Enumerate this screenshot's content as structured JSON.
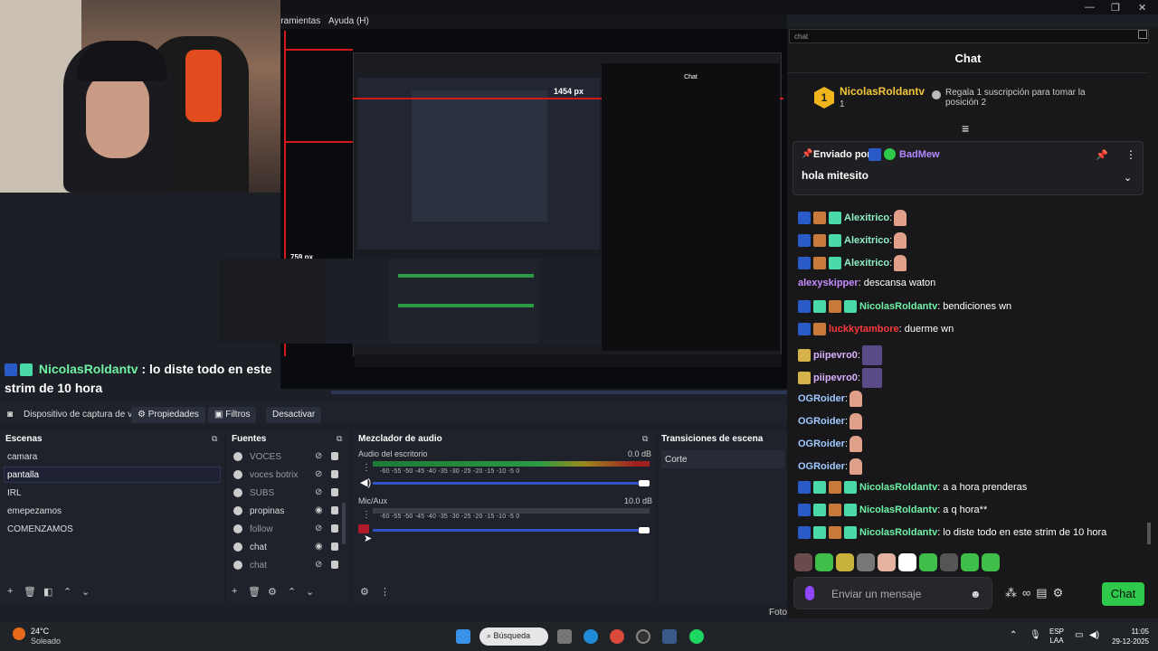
{
  "menubar": {
    "herramientas": "rramientas",
    "ayuda": "Ayuda (H)"
  },
  "window_controls": {
    "min": "—",
    "max": "❐",
    "close": "✕"
  },
  "preview": {
    "px_a": "1454 px",
    "px_b": "759 px",
    "nested_chat_title": "Chat"
  },
  "overlay": {
    "user": "NicolasRoldantv",
    "sep": ":",
    "message": "lo diste todo en este strim de 10 hora"
  },
  "source_bar": {
    "device": "Dispositivo de captura de v",
    "properties": "Propiedades",
    "filters": "Filtros",
    "deactivate": "Desactivar"
  },
  "scenes": {
    "title": "Escenas",
    "items": [
      "camara",
      "pantalla",
      "IRL",
      "emepezamos",
      "COMENZAMOS"
    ]
  },
  "sources": {
    "title": "Fuentes",
    "items": [
      "VOCES",
      "voces botrix",
      "SUBS",
      "propinas",
      "follow",
      "chat",
      "chat"
    ]
  },
  "mixer": {
    "title": "Mezclador de audio",
    "ch1": {
      "name": "Audio del escritorio",
      "db": "0.0 dB"
    },
    "ch2": {
      "name": "Mic/Aux",
      "db": "10.0 dB"
    },
    "scale": "-60    -55    -50    -45    -40    -35    -30    -25    -20    -15    -10     -5      0"
  },
  "transitions": {
    "title": "Transiciones de escena",
    "item": "Corte"
  },
  "chat": {
    "input_top": "chat",
    "title": "Chat",
    "rank_num": "1",
    "rank_name": "NicolasRoldantv",
    "rank_count": "1",
    "rank_sub": "Regala 1 suscripción para tomar la posición 2",
    "pinned_by": "Enviado por",
    "pinned_user": "BadMew",
    "pinned_msg": "hola mitesito",
    "messages": [
      {
        "user": "Alexitrico",
        "text": ":",
        "color": "#8ff0c4"
      },
      {
        "user": "Alexitrico",
        "text": ":",
        "color": "#8ff0c4"
      },
      {
        "user": "Alexitrico",
        "text": ":",
        "color": "#8ff0c4"
      },
      {
        "user": "alexyskipper",
        "text": ": descansa waton",
        "color": "#c68cff"
      },
      {
        "user": "NicolasRoldantv",
        "text": ": bendiciones wn",
        "color": "#6ff2a6"
      },
      {
        "user": "luckkytambore",
        "text": ": duerme wn",
        "color": "#ff3a3a"
      },
      {
        "user": "piipevro0",
        "text": ":",
        "color": "#d9b0ff"
      },
      {
        "user": "piipevro0",
        "text": ":",
        "color": "#d9b0ff"
      },
      {
        "user": "OGRoider",
        "text": ":",
        "color": "#9fc9ff"
      },
      {
        "user": "OGRoider",
        "text": ":",
        "color": "#9fc9ff"
      },
      {
        "user": "OGRoider",
        "text": ":",
        "color": "#9fc9ff"
      },
      {
        "user": "OGRoider",
        "text": ":",
        "color": "#9fc9ff"
      },
      {
        "user": "NicolasRoldantv",
        "text": ": a a hora prenderas",
        "color": "#6ff2a6"
      },
      {
        "user": "NicolasRoldantv",
        "text": ": a q hora**",
        "color": "#6ff2a6"
      },
      {
        "user": "NicolasRoldantv",
        "text": ": lo diste todo en este strim de 10 hora",
        "color": "#6ff2a6"
      }
    ],
    "placeholder": "Enviar un mensaje",
    "send": "Chat"
  },
  "footer": {
    "foto": "Foto"
  },
  "taskbar": {
    "temp": "24°C",
    "cond": "Soleado",
    "search": "Búsqueda",
    "lang1": "ESP",
    "lang2": "LAA",
    "time": "11:05",
    "date": "29-12-2025"
  }
}
